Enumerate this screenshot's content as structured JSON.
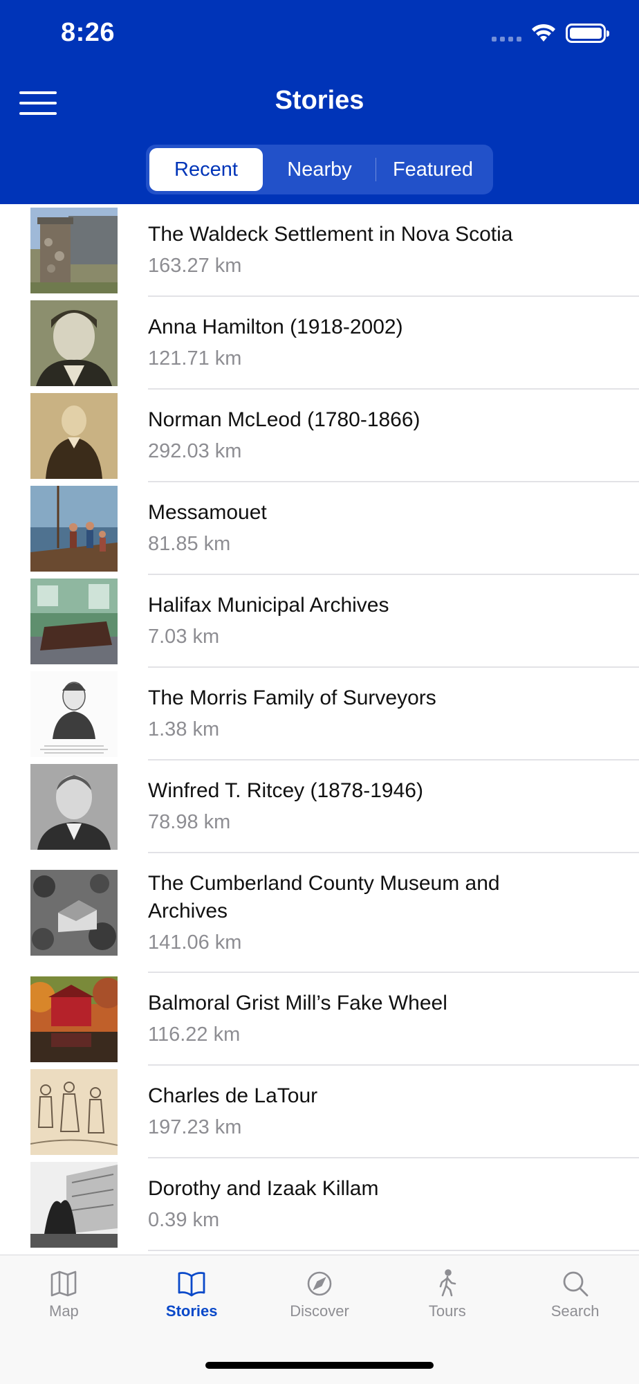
{
  "status_bar": {
    "time": "8:26"
  },
  "header": {
    "title": "Stories"
  },
  "segments": [
    {
      "label": "Recent",
      "active": true
    },
    {
      "label": "Nearby",
      "active": false
    },
    {
      "label": "Featured",
      "active": false
    }
  ],
  "stories": [
    {
      "title": "The Waldeck Settlement in Nova Scotia",
      "distance": "163.27 km",
      "thumb": "stone-monument-house"
    },
    {
      "title": "Anna Hamilton (1918-2002)",
      "distance": "121.71 km",
      "thumb": "portrait-woman-sepia"
    },
    {
      "title": "Norman McLeod (1780-1866)",
      "distance": "292.03 km",
      "thumb": "portrait-man-sepia"
    },
    {
      "title": "Messamouet",
      "distance": "81.85 km",
      "thumb": "painting-ship-people"
    },
    {
      "title": "Halifax Municipal Archives",
      "distance": "7.03 km",
      "thumb": "meeting-room"
    },
    {
      "title": "The Morris Family of Surveyors",
      "distance": "1.38 km",
      "thumb": "engraved-portrait"
    },
    {
      "title": "Winfred T. Ritcey (1878-1946)",
      "distance": "78.98 km",
      "thumb": "portrait-man-bw"
    },
    {
      "title": "The Cumberland County Museum and Archives",
      "distance": "141.06 km",
      "thumb": "aerial-house-bw"
    },
    {
      "title": "Balmoral Grist Mill’s Fake Wheel",
      "distance": "116.22 km",
      "thumb": "red-mill-autumn"
    },
    {
      "title": "Charles de LaTour",
      "distance": "197.23 km",
      "thumb": "sketch-figures"
    },
    {
      "title": "Dorothy and Izaak Killam",
      "distance": "0.39 km",
      "thumb": "modern-building-bw"
    }
  ],
  "tabbar": [
    {
      "label": "Map",
      "icon": "map-icon",
      "active": false
    },
    {
      "label": "Stories",
      "icon": "book-icon",
      "active": true
    },
    {
      "label": "Discover",
      "icon": "compass-icon",
      "active": false
    },
    {
      "label": "Tours",
      "icon": "walking-icon",
      "active": false
    },
    {
      "label": "Search",
      "icon": "search-icon",
      "active": false
    }
  ],
  "colors": {
    "brand": "#0034b8",
    "active_tab": "#0a49c9",
    "inactive_tab": "#8e8e93",
    "distance_text": "#8d8d92"
  }
}
